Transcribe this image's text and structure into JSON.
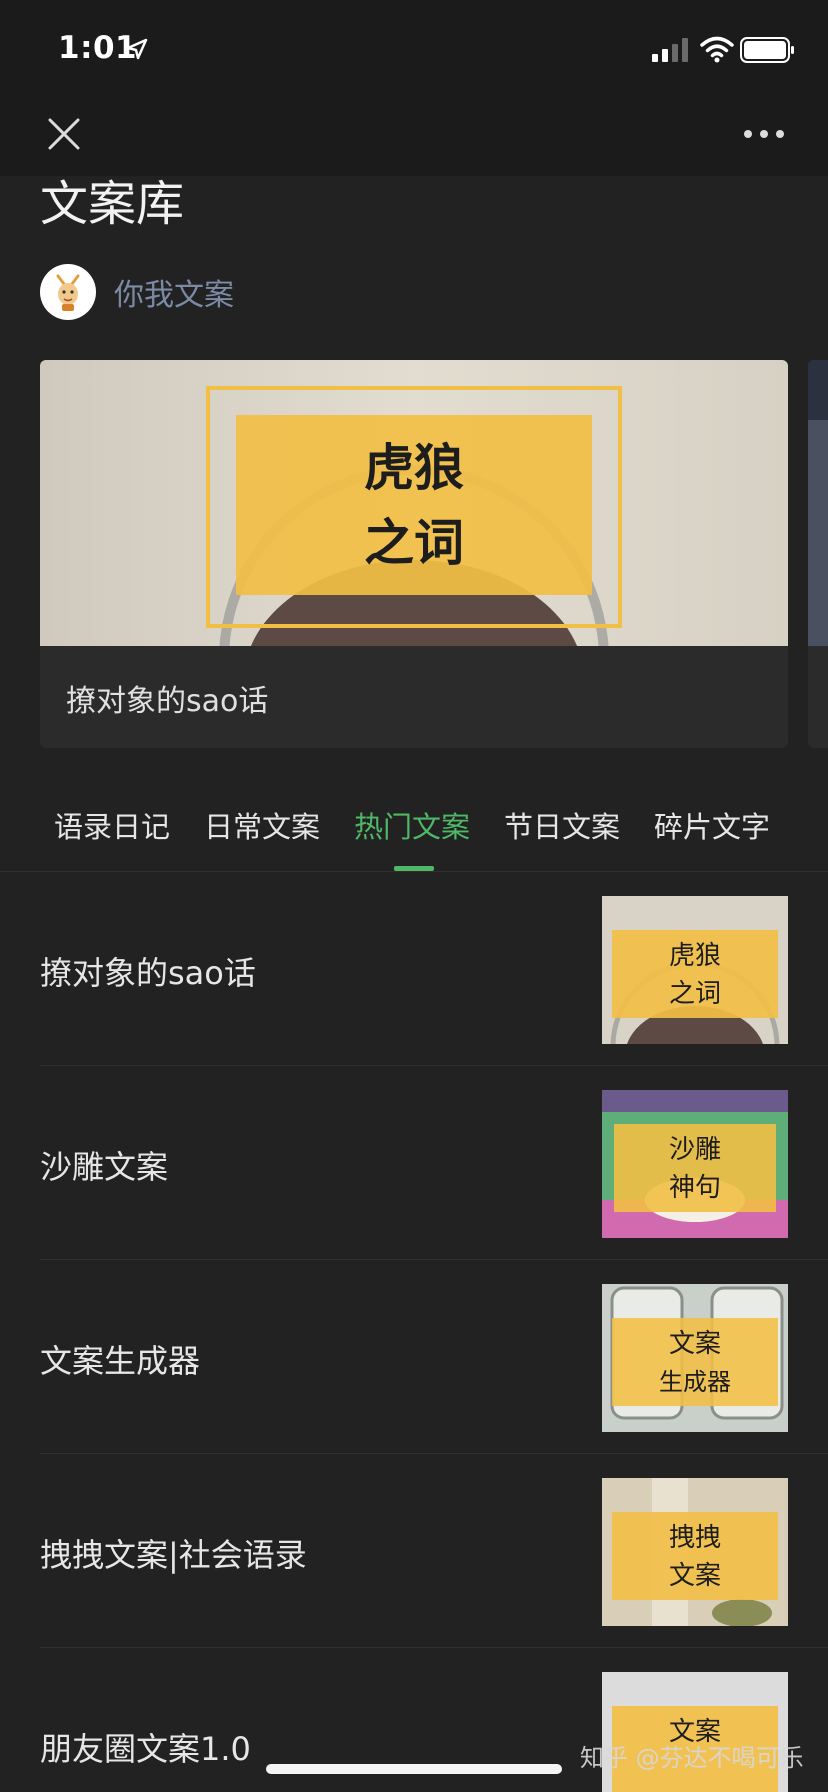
{
  "status": {
    "time": "1:01"
  },
  "page": {
    "title": "文案库"
  },
  "author": {
    "name": "你我文案"
  },
  "banner": {
    "title": "撩对象的sao话",
    "image_text": [
      "虎狼",
      "之词"
    ]
  },
  "tabs": [
    {
      "label": "语录日记"
    },
    {
      "label": "日常文案"
    },
    {
      "label": "热门文案",
      "active": true
    },
    {
      "label": "节日文案"
    },
    {
      "label": "碎片文字"
    }
  ],
  "list": [
    {
      "title": "撩对象的sao话",
      "thumb_text": [
        "虎狼",
        "之词"
      ]
    },
    {
      "title": "沙雕文案",
      "thumb_text": [
        "沙雕",
        "神句"
      ]
    },
    {
      "title": "文案生成器",
      "thumb_text": [
        "文案",
        "生成器"
      ]
    },
    {
      "title": "拽拽文案|社会语录",
      "thumb_text": [
        "拽拽",
        "文案"
      ]
    },
    {
      "title": "朋友圈文案1.0",
      "thumb_text": [
        "文案",
        ""
      ]
    }
  ],
  "watermark": "知乎 @芬达不喝可乐",
  "colors": {
    "accent": "#4fb867",
    "background": "#222222",
    "author": "#7d8aa5",
    "card_yellow": "#f2bf45"
  }
}
